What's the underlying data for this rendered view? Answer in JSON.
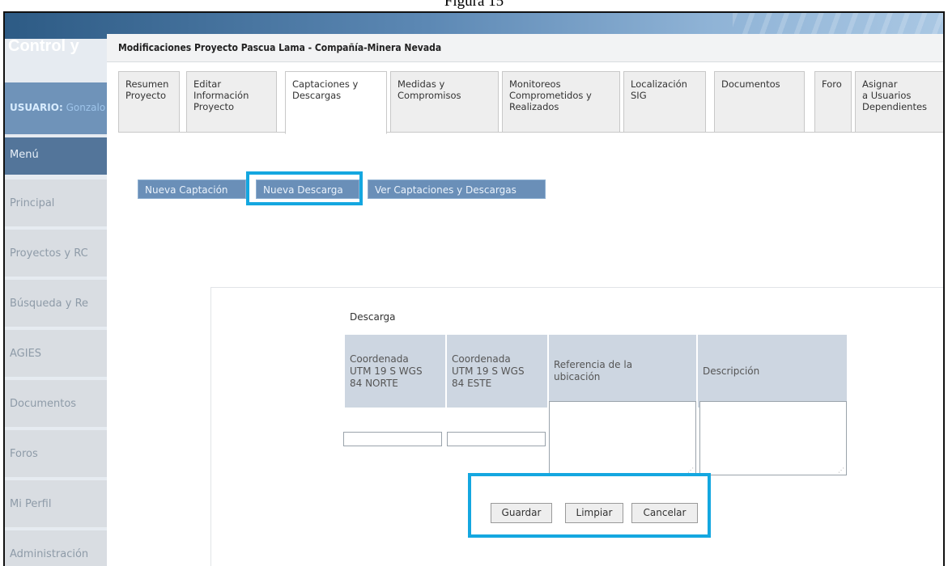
{
  "caption": "Figura 15",
  "app": {
    "title": "Control y"
  },
  "sidebar": {
    "user_label": "USUARIO:",
    "user_name": "Gonzalo",
    "menu_header": "Menú",
    "items": [
      {
        "label": "Principal"
      },
      {
        "label": "Proyectos y RC"
      },
      {
        "label": "Búsqueda y Re"
      },
      {
        "label": "AGIES"
      },
      {
        "label": "Documentos"
      },
      {
        "label": "Foros"
      },
      {
        "label": "Mi Perfil"
      },
      {
        "label": "Administración"
      }
    ]
  },
  "panel": {
    "title": "Modificaciones Proyecto Pascua Lama - Compañía-Minera Nevada"
  },
  "tabs": [
    {
      "line1": "Resumen",
      "line2": "Proyecto",
      "line3": ""
    },
    {
      "line1": "Editar",
      "line2": "Información",
      "line3": "Proyecto"
    },
    {
      "line1": "Captaciones y",
      "line2": "Descargas",
      "line3": ""
    },
    {
      "line1": "Medidas y",
      "line2": "Compromisos",
      "line3": ""
    },
    {
      "line1": "Monitoreos",
      "line2": "Comprometidos y",
      "line3": "Realizados"
    },
    {
      "line1": "Localización",
      "line2": "SIG",
      "line3": ""
    },
    {
      "line1": "Documentos",
      "line2": "",
      "line3": ""
    },
    {
      "line1": "Foro",
      "line2": "",
      "line3": ""
    },
    {
      "line1": "Asignar",
      "line2": "a Usuarios",
      "line3": "Dependientes"
    }
  ],
  "active_tab": "Captaciones y Descargas",
  "subnav": {
    "nueva_captacion": "Nueva Captación",
    "nueva_descarga": "Nueva Descarga",
    "ver": "Ver Captaciones y Descargas"
  },
  "form": {
    "title": "Descarga",
    "columns": [
      {
        "l1": "Coordenada",
        "l2": "UTM 19 S WGS",
        "l3": "84 NORTE"
      },
      {
        "l1": "Coordenada",
        "l2": "UTM 19 S WGS",
        "l3": "84 ESTE"
      },
      {
        "l1": "Referencia de la",
        "l2": "ubicación",
        "l3": ""
      },
      {
        "l1": "Descripción",
        "l2": "",
        "l3": ""
      }
    ],
    "values": {
      "norte": "",
      "este": "",
      "referencia": "",
      "descripcion": ""
    },
    "buttons": {
      "guardar": "Guardar",
      "limpiar": "Limpiar",
      "cancelar": "Cancelar"
    }
  },
  "colors": {
    "highlight": "#14a7e0",
    "subnav_bg": "#6a8fb8",
    "header_cell_bg": "#cdd6e1"
  }
}
